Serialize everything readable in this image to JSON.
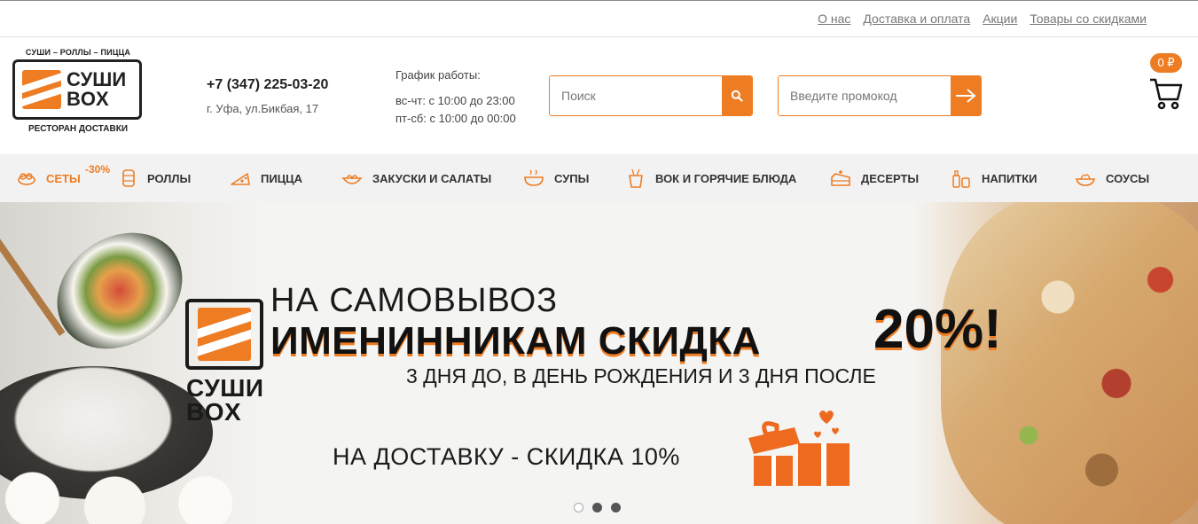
{
  "toplinks": [
    {
      "label": "О нас"
    },
    {
      "label": "Доставка и оплата"
    },
    {
      "label": "Акции"
    },
    {
      "label": "Товары со скидками"
    }
  ],
  "logo": {
    "tagline": "СУШИ – РОЛЛЫ – ПИЦЦА",
    "name_line1": "СУШИ",
    "name_line2": "BOX",
    "subtitle": "РЕСТОРАН ДОСТАВКИ"
  },
  "contact": {
    "phone": "+7 (347) 225-03-20",
    "address": "г. Уфа, ул.Бикбая, 17"
  },
  "schedule": {
    "title": "График работы:",
    "line1": "вс-чт: с 10:00 до 23:00",
    "line2": "пт-сб: с 10:00 до 00:00"
  },
  "search": {
    "placeholder": "Поиск",
    "icon": "search-icon"
  },
  "promo": {
    "placeholder": "Введите промокод",
    "icon": "arrow-right-icon"
  },
  "cart": {
    "amount": "0 ₽",
    "icon": "cart-icon"
  },
  "nav": {
    "sets_badge": "-30%",
    "items": [
      {
        "label": "Сеты",
        "icon": "sets-icon"
      },
      {
        "label": "Роллы",
        "icon": "rolls-icon"
      },
      {
        "label": "Пицца",
        "icon": "pizza-icon"
      },
      {
        "label": "Закуски и салаты",
        "icon": "salad-icon"
      },
      {
        "label": "Супы",
        "icon": "soup-icon"
      },
      {
        "label": "Вок и горячие блюда",
        "icon": "wok-icon"
      },
      {
        "label": "Десерты",
        "icon": "dessert-icon"
      },
      {
        "label": "Напитки",
        "icon": "drinks-icon"
      },
      {
        "label": "Соусы",
        "icon": "sauce-icon"
      }
    ]
  },
  "banner": {
    "logo_line1": "СУШИ",
    "logo_line2": "BOX",
    "line1": "НА САМОВЫВОЗ",
    "line2": "ИМЕНИННИКАМ СКИДКА",
    "percent": "20%!",
    "line3": "3 ДНЯ ДО, В ДЕНЬ РОЖДЕНИЯ И 3 ДНЯ ПОСЛЕ",
    "line4": "НА ДОСТАВКУ - СКИДКА 10%",
    "slides": 3,
    "active_slide": 1
  },
  "colors": {
    "accent": "#ee7c22",
    "nav_bg": "#f2f2f2"
  }
}
